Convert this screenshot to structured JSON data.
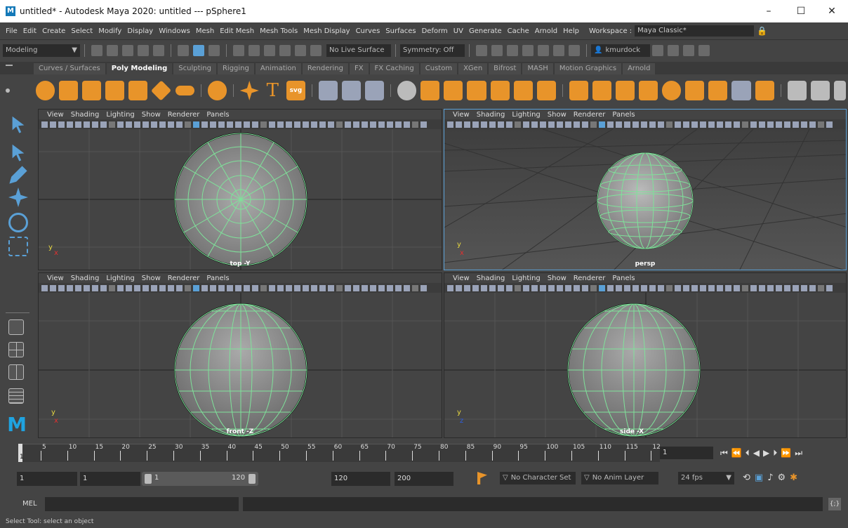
{
  "window": {
    "title": "untitled* - Autodesk Maya 2020: untitled  ---  pSphere1",
    "logo": "M",
    "minimize": "–",
    "maximize": "☐",
    "close": "✕"
  },
  "menu": {
    "items": [
      "File",
      "Edit",
      "Create",
      "Select",
      "Modify",
      "Display",
      "Windows",
      "Mesh",
      "Edit Mesh",
      "Mesh Tools",
      "Mesh Display",
      "Curves",
      "Surfaces",
      "Deform",
      "UV",
      "Generate",
      "Cache",
      "Arnold",
      "Help"
    ],
    "workspace_label": "Workspace :",
    "workspace_value": "Maya Classic*"
  },
  "statusline": {
    "mode": "Modeling",
    "live_surface": "No Live Surface",
    "symmetry": "Symmetry: Off",
    "user": "kmurdock"
  },
  "shelf": {
    "tabs": [
      "Curves / Surfaces",
      "Poly Modeling",
      "Sculpting",
      "Rigging",
      "Animation",
      "Rendering",
      "FX",
      "FX Caching",
      "Custom",
      "XGen",
      "Bifrost",
      "MASH",
      "Motion Graphics",
      "Arnold"
    ],
    "active_tab": "Poly Modeling",
    "text_tool": "T",
    "svg_tool": "svg"
  },
  "viewport_menu": [
    "View",
    "Shading",
    "Lighting",
    "Show",
    "Renderer",
    "Panels"
  ],
  "viewports": {
    "top": {
      "camera": "top -Y",
      "axis_x": "x",
      "axis_y": "y"
    },
    "persp": {
      "camera": "persp",
      "axis_x": "x",
      "axis_y": "y"
    },
    "front": {
      "camera": "front -Z",
      "axis_x": "x",
      "axis_y": "y"
    },
    "side": {
      "camera": "side -X",
      "axis_x": "z",
      "axis_y": "y"
    }
  },
  "timeslider": {
    "ticks": [
      "5",
      "10",
      "15",
      "20",
      "25",
      "30",
      "35",
      "40",
      "45",
      "50",
      "55",
      "60",
      "65",
      "70",
      "75",
      "80",
      "85",
      "90",
      "95",
      "100",
      "105",
      "110",
      "115",
      "12"
    ],
    "first_tick": "1",
    "current_frame": "1"
  },
  "range": {
    "start_time": "1",
    "playback_start": "1",
    "slider_start": "1",
    "slider_end": "120",
    "playback_end": "120",
    "end_time": "200",
    "character_set": "No Character Set",
    "anim_layer": "No Anim Layer",
    "fps": "24 fps"
  },
  "mel": {
    "label": "MEL"
  },
  "help_line": "Select Tool: select an object",
  "colors": {
    "wire": "#7fe29a",
    "accent": "#5aa0d6",
    "background": "#444444"
  }
}
